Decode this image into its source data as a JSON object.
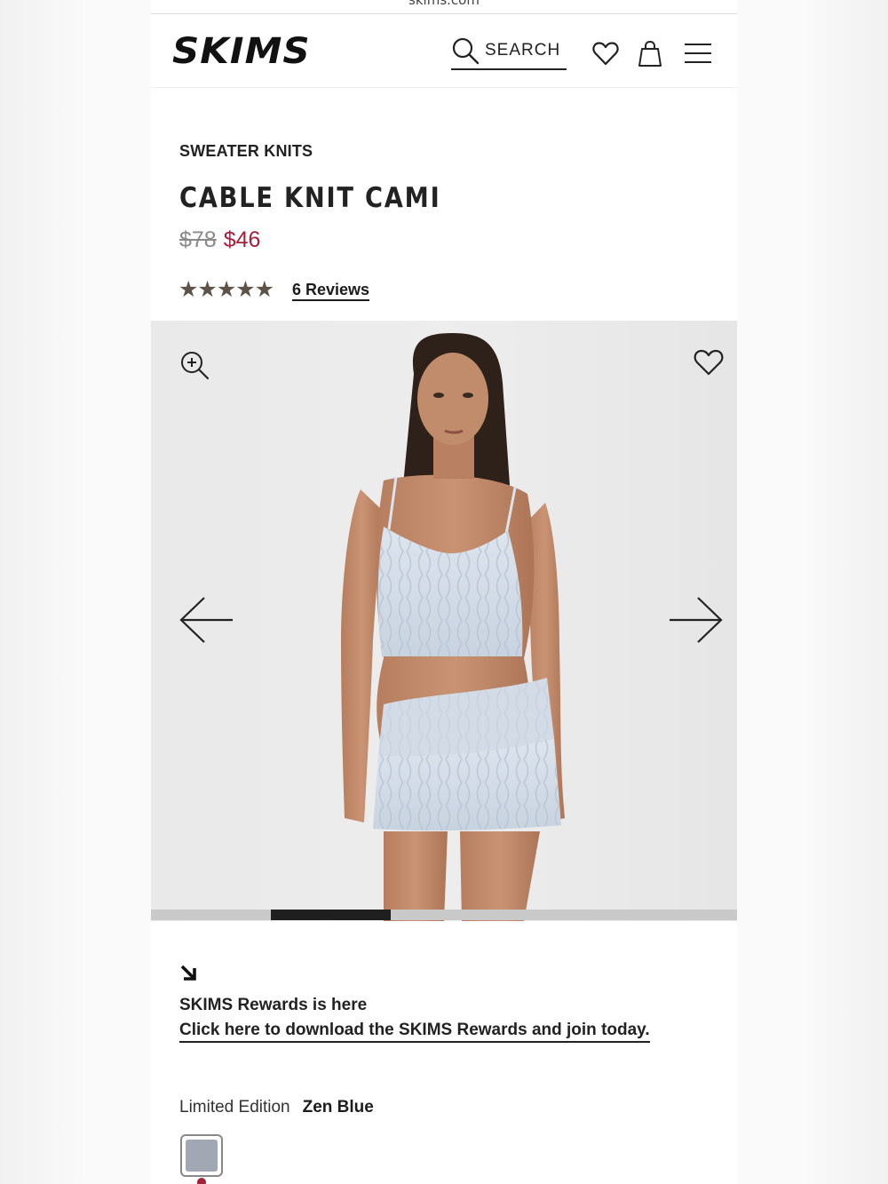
{
  "browser": {
    "url": "skims.com"
  },
  "header": {
    "logo": "SKIMS",
    "search_label": "SEARCH"
  },
  "product": {
    "category": "SWEATER KNITS",
    "title": "CABLE KNIT CAMI",
    "original_price": "$78",
    "sale_price": "$46",
    "rating": 5,
    "stars": "★★★★★",
    "reviews_label": "6 Reviews"
  },
  "gallery": {
    "current_slide_fraction": {
      "start": 0.2045,
      "end": 0.409
    }
  },
  "promo": {
    "title": "SKIMS Rewards is here",
    "link": "Click here to download the SKIMS Rewards and join today."
  },
  "color": {
    "edition_label": "Limited Edition",
    "name": "Zen Blue",
    "swatch_color": "#a1a8b3"
  },
  "colors": {
    "sale": "#a3213b",
    "star": "#5d5348"
  }
}
